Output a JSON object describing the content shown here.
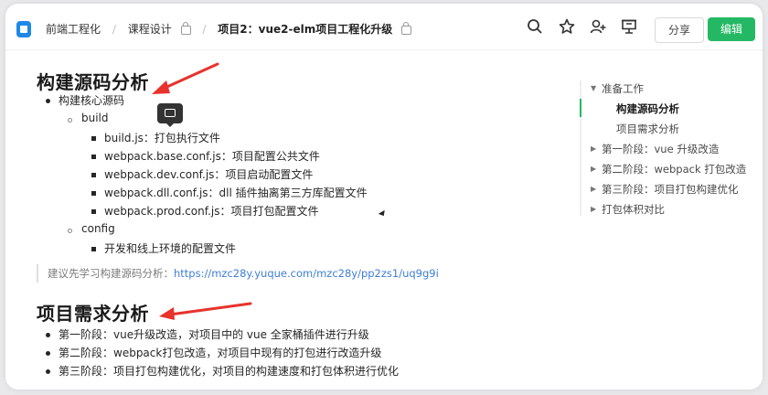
{
  "header": {
    "breadcrumb": [
      "前端工程化",
      "课程设计",
      "项目2：vue2-elm项目工程化升级"
    ],
    "icons": [
      "search-icon",
      "star-icon",
      "add-user-icon",
      "present-icon"
    ],
    "share_label": "分享",
    "edit_label": "编辑",
    "accent_color": "#25b864"
  },
  "doc": {
    "section1_title": "构建源码分析",
    "section1": {
      "item1": "构建核心源码",
      "build_label": "build",
      "build_items": [
        "build.js：打包执行文件",
        "webpack.base.conf.js：项目配置公共文件",
        "webpack.dev.conf.js：项目启动配置文件",
        "webpack.dll.conf.js：dll 插件抽离第三方库配置文件",
        "webpack.prod.conf.js：项目打包配置文件"
      ],
      "config_label": "config",
      "config_items": [
        "开发和线上环境的配置文件"
      ]
    },
    "quote_prefix": "建议先学习构建源码分析：",
    "quote_link": "https://mzc28y.yuque.com/mzc28y/pp2zs1/uq9g9i",
    "section2_title": "项目需求分析",
    "section2_items": [
      "第一阶段：vue升级改造，对项目中的 vue 全家桶插件进行升级",
      "第二阶段：webpack打包改造，对项目中现有的打包进行改造升级",
      "第三阶段：项目打包构建优化，对项目的构建速度和打包体积进行优化"
    ]
  },
  "toc": {
    "items": [
      "准备工作",
      "构建源码分析",
      "项目需求分析",
      "第一阶段：vue 升级改造",
      "第二阶段：webpack 打包改造",
      "第三阶段：项目打包构建优化",
      "打包体积对比"
    ],
    "active_index": 1
  },
  "annotation_color": "#e8322b"
}
